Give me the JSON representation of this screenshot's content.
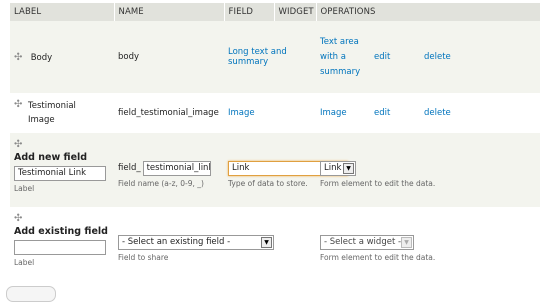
{
  "headers": {
    "label": "LABEL",
    "name": "NAME",
    "field": "FIELD",
    "widget": "WIDGET",
    "operations": "OPERATIONS"
  },
  "rows": [
    {
      "label": "Body",
      "name": "body",
      "field": "Long text and summary",
      "widget": "Text area with a summary",
      "edit": "edit",
      "delete": "delete"
    },
    {
      "label": "Testimonial Image",
      "name": "field_testimonial_image",
      "field": "Image",
      "widget": "Image",
      "edit": "edit",
      "delete": "delete"
    }
  ],
  "add_new": {
    "title": "Add new field",
    "label_value": "Testimonial Link",
    "label_caption": "Label",
    "name_prefix": "field_",
    "name_value": "testimonial_link",
    "name_description": "Field name (a-z, 0-9, _)",
    "type_value": "Link",
    "type_description": "Type of data to store.",
    "widget_value": "Link",
    "widget_description": "Form element to edit the data."
  },
  "add_existing": {
    "title": "Add existing field",
    "label_value": "",
    "label_caption": "Label",
    "field_select": "- Select an existing field -",
    "field_description": "Field to share",
    "widget_select": "- Select a widget -",
    "widget_description": "Form element to edit the data."
  },
  "icons": {
    "drag": "cross-arrows-icon",
    "select_arrow": "chevron-down-icon"
  },
  "colors": {
    "link": "#0074bd",
    "header_bg": "#e1e2dc",
    "odd_row_bg": "#f3f4ee",
    "focus_border": "#e0a040"
  }
}
